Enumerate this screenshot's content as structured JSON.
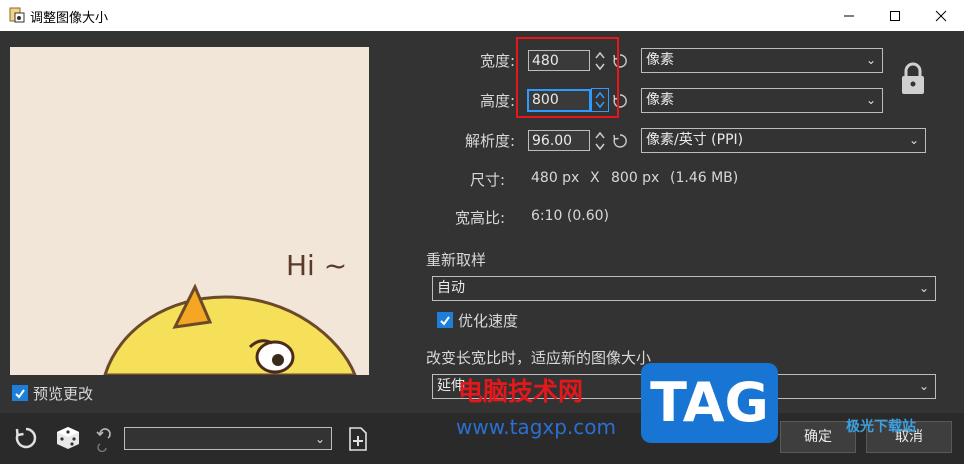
{
  "window": {
    "title": "调整图像大小",
    "minimize_icon": "minimize-icon",
    "maximize_icon": "maximize-icon",
    "close_icon": "close-icon"
  },
  "preview": {
    "image_text": "Hi ~",
    "checkbox_label": "预览更改",
    "checked": true
  },
  "size": {
    "width_label": "宽度:",
    "width_value": "480",
    "width_unit": "像素",
    "height_label": "高度:",
    "height_value": "800",
    "height_unit": "像素",
    "resolution_label": "解析度:",
    "resolution_value": "96.00",
    "resolution_unit": "像素/英寸 (PPI)",
    "dimension_label": "尺寸:",
    "dimension_w": "480 px",
    "dimension_x": "X",
    "dimension_h": "800 px",
    "dimension_size": "(1.46 MB)",
    "ratio_label": "宽高比:",
    "ratio_value": "6:10 (0.60)",
    "lock_icon": "lock-icon"
  },
  "resample": {
    "label": "重新取样",
    "selected": "自动",
    "optimize_label": "优化速度",
    "optimize_checked": true
  },
  "aspect_change": {
    "label": "改变长宽比时，适应新的图像大小",
    "selected": "延伸"
  },
  "bottom": {
    "preset_value": "",
    "ok_label": "确定",
    "cancel_label": "取消"
  },
  "watermark": {
    "site_name": "电脑技术网",
    "site_url": "www.tagxp.com",
    "tag_text": "TAG",
    "corner_text": "极光下载站"
  },
  "colors": {
    "accent": "#2f9aff",
    "highlight_box": "#e4171b",
    "background": "#333333"
  }
}
